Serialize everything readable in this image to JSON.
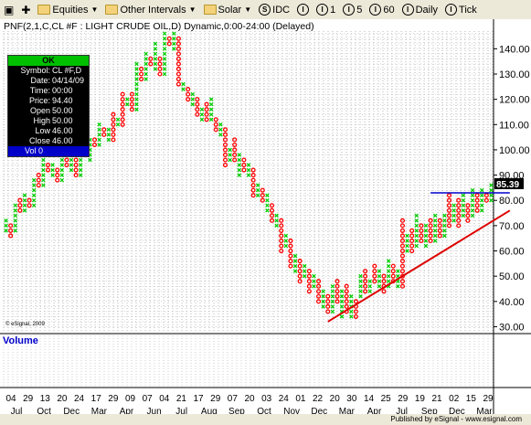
{
  "toolbar": {
    "items": [
      {
        "label": "",
        "icon": "new-window-icon"
      },
      {
        "label": "",
        "icon": "plus-icon"
      },
      {
        "label": "Equities",
        "icon": "folder-icon",
        "dropdown": true
      },
      {
        "label": "Other Intervals",
        "icon": "folder-icon",
        "dropdown": true
      },
      {
        "label": "Solar",
        "icon": "folder-icon",
        "dropdown": true
      },
      {
        "label": "IDC",
        "icon": "S"
      },
      {
        "label": "",
        "icon": "I"
      },
      {
        "label": "1",
        "icon": "I"
      },
      {
        "label": "5",
        "icon": "I"
      },
      {
        "label": "60",
        "icon": "I"
      },
      {
        "label": "Daily",
        "icon": "I"
      },
      {
        "label": "Tick",
        "icon": "I"
      }
    ]
  },
  "chart": {
    "title": "PNF(2,1,C,CL #F : LIGHT CRUDE OIL,D) Dynamic,0:00-24:00 (Delayed)",
    "copyright": "© eSignal, 2009",
    "volume_label": "Volume",
    "last_price_tag": "85.39",
    "colors": {
      "x_up": "#00cc00",
      "o_down": "#ff0000",
      "trendline": "#dd0000",
      "resistance": "#0000cc",
      "price_tag_bg": "#000000"
    }
  },
  "infobox": {
    "ok_label": "OK",
    "rows": [
      {
        "label": "Symbol:",
        "value": "CL #F,D"
      },
      {
        "label": "Date:",
        "value": "04/14/09"
      },
      {
        "label": "Time:",
        "value": "00:00"
      },
      {
        "label": "Price:",
        "value": "94.40"
      },
      {
        "label": "Open",
        "value": "50.00"
      },
      {
        "label": "High",
        "value": "50.00"
      },
      {
        "label": "Low",
        "value": "46.00"
      },
      {
        "label": "Close",
        "value": "46.00"
      }
    ],
    "vol_label": "Vol 0"
  },
  "status_bar": {
    "text": "Published by eSignal - www.esignal.com"
  },
  "chart_data": {
    "type": "point-and-figure",
    "box_size": 2,
    "reversal": 1,
    "y_ticks": [
      30,
      40,
      50,
      60,
      70,
      80,
      90,
      100,
      110,
      120,
      130,
      140
    ],
    "ylim": [
      28,
      147
    ],
    "x_tick_days": [
      "04",
      "29",
      "13",
      "20",
      "24",
      "17",
      "29",
      "09",
      "07",
      "04",
      "21",
      "17",
      "29",
      "07",
      "20",
      "03",
      "24",
      "01",
      "22",
      "20",
      "30",
      "14",
      "25",
      "29",
      "19",
      "21",
      "02",
      "15",
      "29"
    ],
    "x_tick_months": [
      "Jul",
      "Oct",
      "Dec",
      "Mar",
      "Apr",
      "Jun",
      "Jul",
      "Aug",
      "Sep",
      "Oct",
      "Nov",
      "Dec",
      "Mar",
      "Apr",
      "Jul",
      "Sep",
      "Dec",
      "Mar"
    ],
    "series": [
      {
        "values": [
          [
            68,
            72
          ],
          [
            66,
            70
          ],
          [
            68,
            78
          ],
          [
            76,
            80
          ],
          [
            76,
            82
          ],
          [
            78,
            80
          ],
          [
            78,
            88
          ],
          [
            86,
            90
          ],
          [
            86,
            96
          ],
          [
            92,
            94
          ],
          [
            90,
            94
          ],
          [
            88,
            92
          ],
          [
            88,
            98
          ],
          [
            94,
            96
          ],
          [
            92,
            98
          ],
          [
            90,
            96
          ],
          [
            90,
            100
          ],
          [
            98,
            100
          ],
          [
            96,
            104
          ],
          [
            102,
            104
          ],
          [
            102,
            110
          ],
          [
            106,
            108
          ],
          [
            104,
            108
          ],
          [
            104,
            114
          ],
          [
            110,
            112
          ],
          [
            110,
            122
          ],
          [
            118,
            120
          ],
          [
            116,
            122
          ],
          [
            116,
            134
          ],
          [
            128,
            132
          ],
          [
            128,
            138
          ],
          [
            134,
            136
          ],
          [
            132,
            142
          ],
          [
            130,
            136
          ],
          [
            130,
            146
          ],
          [
            142,
            144
          ],
          [
            140,
            146
          ],
          [
            126,
            144
          ],
          [
            124,
            126
          ],
          [
            120,
            124
          ],
          [
            118,
            122
          ],
          [
            114,
            120
          ],
          [
            112,
            116
          ],
          [
            112,
            118
          ],
          [
            112,
            120
          ],
          [
            108,
            112
          ],
          [
            106,
            110
          ],
          [
            94,
            108
          ],
          [
            96,
            100
          ],
          [
            96,
            104
          ],
          [
            90,
            98
          ],
          [
            92,
            96
          ],
          [
            90,
            94
          ],
          [
            82,
            92
          ],
          [
            82,
            86
          ],
          [
            80,
            84
          ],
          [
            76,
            82
          ],
          [
            72,
            78
          ],
          [
            70,
            74
          ],
          [
            60,
            72
          ],
          [
            62,
            66
          ],
          [
            54,
            64
          ],
          [
            52,
            58
          ],
          [
            48,
            56
          ],
          [
            50,
            54
          ],
          [
            44,
            52
          ],
          [
            46,
            50
          ],
          [
            40,
            48
          ],
          [
            38,
            44
          ],
          [
            36,
            42
          ],
          [
            36,
            46
          ],
          [
            40,
            48
          ],
          [
            34,
            44
          ],
          [
            36,
            46
          ],
          [
            34,
            42
          ],
          [
            34,
            40
          ],
          [
            42,
            50
          ],
          [
            44,
            52
          ],
          [
            44,
            48
          ],
          [
            48,
            54
          ],
          [
            46,
            52
          ],
          [
            44,
            50
          ],
          [
            46,
            56
          ],
          [
            48,
            54
          ],
          [
            46,
            52
          ],
          [
            46,
            72
          ],
          [
            60,
            66
          ],
          [
            60,
            68
          ],
          [
            62,
            74
          ],
          [
            64,
            70
          ],
          [
            62,
            70
          ],
          [
            64,
            72
          ],
          [
            64,
            74
          ],
          [
            66,
            72
          ],
          [
            66,
            74
          ],
          [
            70,
            82
          ],
          [
            72,
            78
          ],
          [
            70,
            80
          ],
          [
            74,
            82
          ],
          [
            72,
            78
          ],
          [
            74,
            84
          ],
          [
            76,
            82
          ],
          [
            76,
            84
          ],
          [
            80,
            82
          ],
          [
            80,
            86
          ]
        ]
      }
    ],
    "annotations": [
      {
        "type": "trendline",
        "from": [
          69,
          32
        ],
        "to": [
          108,
          76
        ]
      },
      {
        "type": "resistance",
        "level": 83,
        "from": 91,
        "to": 108
      }
    ]
  }
}
